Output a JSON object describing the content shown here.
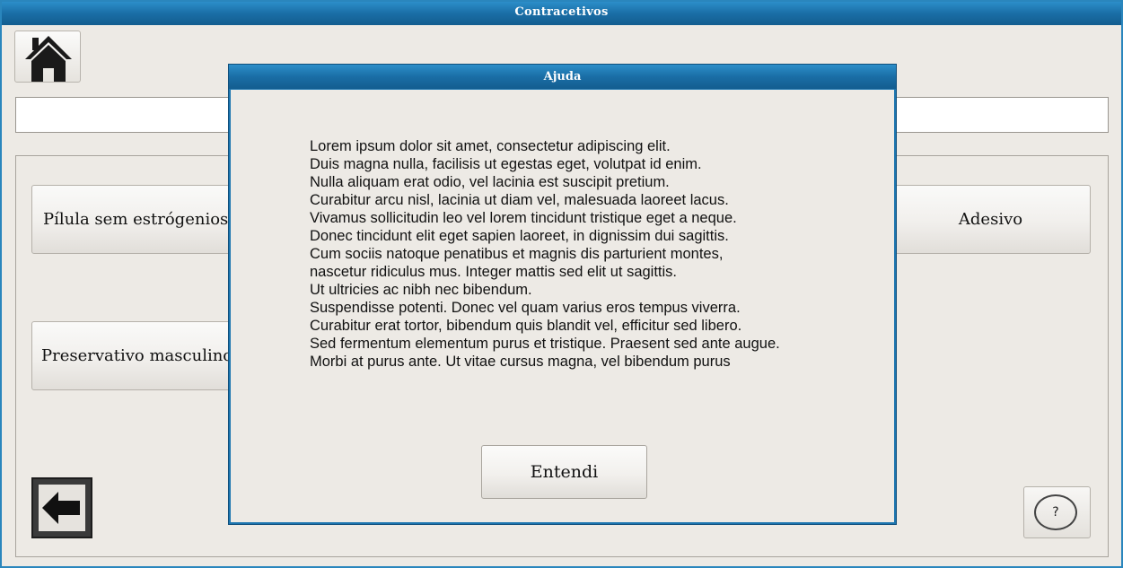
{
  "window": {
    "title": "Contracetivos"
  },
  "search": {
    "value": ""
  },
  "options": [
    {
      "label": "Pílula sem estrógenios"
    },
    {
      "label": "Adesivo"
    },
    {
      "label": "Preservativo masculino"
    }
  ],
  "help_button": {
    "label": "?"
  },
  "dialog": {
    "title": "Ajuda",
    "lines": [
      "Lorem ipsum dolor sit amet, consectetur adipiscing elit.",
      "Duis magna nulla, facilisis ut egestas eget, volutpat id enim.",
      "Nulla aliquam erat odio, vel lacinia est suscipit pretium.",
      "Curabitur arcu nisl, lacinia ut diam vel, malesuada laoreet lacus.",
      "Vivamus sollicitudin leo vel lorem tincidunt tristique eget a neque.",
      "Donec tincidunt elit eget sapien laoreet, in dignissim dui sagittis.",
      "Cum sociis natoque penatibus et magnis dis parturient montes,",
      "nascetur ridiculus mus. Integer mattis sed elit ut sagittis.",
      "Ut ultricies ac nibh nec bibendum.",
      "Suspendisse potenti. Donec vel quam varius eros tempus viverra.",
      "Curabitur erat tortor, bibendum quis blandit vel, efficitur sed libero.",
      "Sed fermentum elementum purus et tristique. Praesent sed ante augue.",
      "Morbi at purus ante. Ut vitae cursus magna, vel bibendum purus"
    ],
    "ok_label": "Entendi"
  },
  "icons": {
    "home": "home-icon",
    "back": "arrow-left-icon"
  },
  "colors": {
    "titlebar": "#1a6ea6",
    "background": "#edeae5"
  }
}
